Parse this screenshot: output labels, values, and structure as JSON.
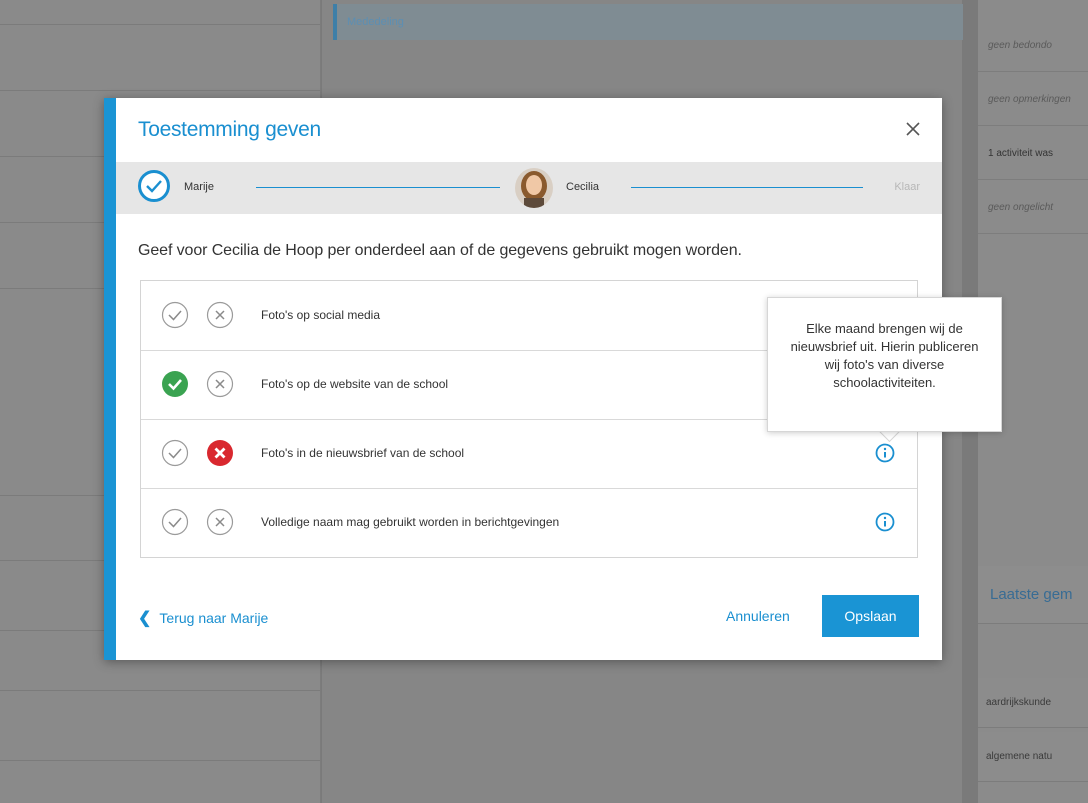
{
  "background": {
    "tab_label": "Mededeling",
    "right_items": [
      "geen bedondo",
      "geen opmerkingen",
      "1 activiteit was",
      "geen ongelicht"
    ],
    "right_title": "Laatste gem",
    "right_list": [
      "aardrijkskunde",
      "algemene natu"
    ]
  },
  "modal": {
    "title": "Toestemming geven",
    "steps": {
      "first": "Marije",
      "second": "Cecilia",
      "done": "Klaar"
    },
    "instruction": "Geef voor Cecilia de Hoop per onderdeel aan of de gegevens gebruikt mogen worden.",
    "items": [
      {
        "label": "Foto's op social media",
        "state": "none",
        "info": false
      },
      {
        "label": "Foto's op de website van de school",
        "state": "yes",
        "info": false
      },
      {
        "label": "Foto's in de nieuwsbrief van de school",
        "state": "no",
        "info": true
      },
      {
        "label": "Volledige naam mag gebruikt worden in berichtgevingen",
        "state": "none",
        "info": true
      }
    ],
    "tooltip": "Elke maand brengen wij de nieuwsbrief uit. Hierin publiceren wij foto's van diverse schoolactiviteiten.",
    "back_label": "Terug naar Marije",
    "cancel_label": "Annuleren",
    "save_label": "Opslaan"
  },
  "colors": {
    "accent": "#1a94d4",
    "yes": "#3aa351",
    "no": "#d9282f"
  }
}
